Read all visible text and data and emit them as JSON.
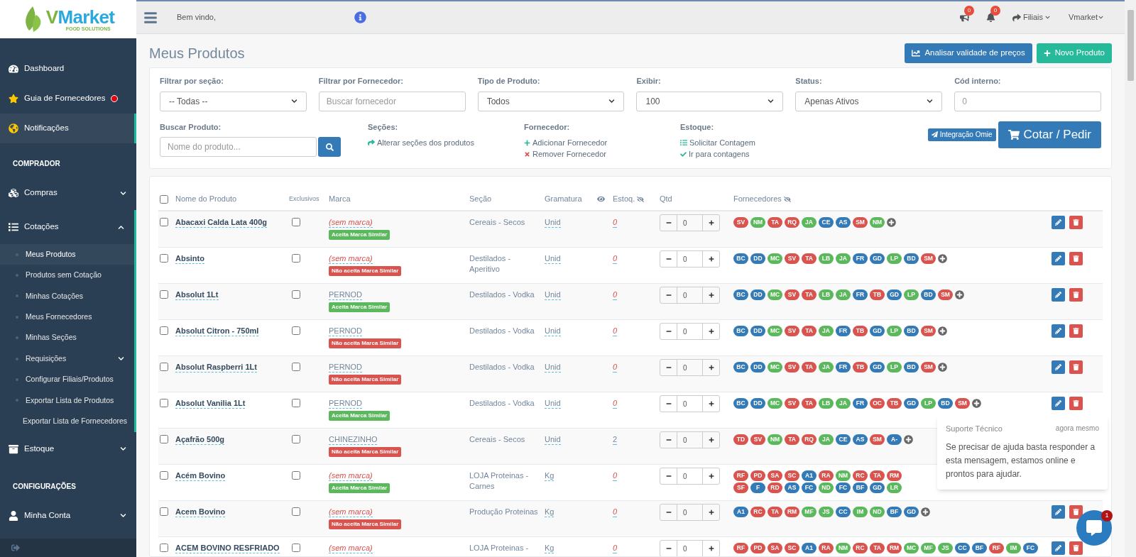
{
  "sidebar": {
    "logo_mark": "V",
    "logo_word": "Market",
    "logo_tagline": "FOOD SOLUTIONS",
    "items": [
      {
        "kind": "link",
        "label": "Dashboard",
        "selected": false,
        "alert": false
      },
      {
        "kind": "link",
        "label": "Guia de Fornecedores",
        "selected": false,
        "alert": true
      },
      {
        "kind": "link",
        "label": "Notificações",
        "selected": true,
        "alert": false
      },
      {
        "kind": "header",
        "label": "COMPRADOR"
      },
      {
        "kind": "group",
        "label": "Compras",
        "expanded": false
      },
      {
        "kind": "group",
        "label": "Cotações",
        "expanded": true,
        "children": [
          {
            "label": "Meus Produtos",
            "selected": true
          },
          {
            "label": "Produtos sem Cotação",
            "selected": false
          },
          {
            "label": "Minhas Cotações",
            "selected": false
          },
          {
            "label": "Meus Fornecedores",
            "selected": false
          },
          {
            "label": "Minhas Seções",
            "selected": false
          },
          {
            "label": "Requisições",
            "selected": false,
            "expandable": true
          },
          {
            "label": "Configurar Filiais/Produtos",
            "selected": false
          },
          {
            "label": "Exportar Lista de Produtos",
            "selected": false
          },
          {
            "label": "Exportar Lista de Fornecedores",
            "selected": false
          }
        ]
      },
      {
        "kind": "group",
        "label": "Estoque",
        "expanded": false
      },
      {
        "kind": "header",
        "label": "CONFIGURAÇÕES"
      },
      {
        "kind": "group",
        "label": "Minha Conta",
        "expanded": false
      }
    ]
  },
  "header": {
    "welcome": "Bem vindo,",
    "counters": [
      "0",
      "0"
    ],
    "branches": "Filiais",
    "user": "Vmarket"
  },
  "page": {
    "title": "Meus Produtos",
    "buttons": [
      {
        "kind": "primary",
        "label": "Analisar validade de preços"
      },
      {
        "kind": "success",
        "label": "Novo Produto"
      }
    ]
  },
  "filters": [
    {
      "kind": "select",
      "label": "Filtrar por seção:",
      "value": "-- Todas --"
    },
    {
      "kind": "input",
      "label": "Filtrar por Fornecedor:",
      "placeholder": "Buscar fornecedor"
    },
    {
      "kind": "select",
      "label": "Tipo de Produto:",
      "value": "Todos"
    },
    {
      "kind": "select",
      "label": "Exibir:",
      "value": "100"
    },
    {
      "kind": "select",
      "label": "Status:",
      "value": "Apenas Ativos"
    },
    {
      "kind": "input",
      "label": "Cód interno:",
      "placeholder": "0"
    }
  ],
  "search": {
    "label": "Buscar Produto:",
    "placeholder": "Nome do produto..."
  },
  "action_groups": [
    {
      "title": "Seções:",
      "links": [
        {
          "kind": "share",
          "text": "Alterar seções dos produtos"
        }
      ]
    },
    {
      "title": "Fornecedor:",
      "links": [
        {
          "kind": "add",
          "text": "Adicionar Fornecedor"
        },
        {
          "kind": "remove",
          "text": "Remover Fornecedor"
        }
      ]
    },
    {
      "title": "Estoque:",
      "links": [
        {
          "kind": "list",
          "text": "Solicitar Contagem"
        },
        {
          "kind": "check",
          "text": "Ir para contagens"
        }
      ]
    }
  ],
  "integration_button": "Integração Omie",
  "quote_button": "Cotar / Pedir",
  "table": {
    "select_all_checked": false,
    "columns": [
      "Nome do Produto",
      "Exclusivos",
      "Marca",
      "Seção",
      "Gramatura",
      "Estoq.",
      "Qtd",
      "Fornecedores"
    ],
    "rows": [
      {
        "checked": false,
        "name": "Abacaxi Calda Lata 400g",
        "exclusive": false,
        "brand": "(sem marca)",
        "brand_missing": true,
        "similar": {
          "text": "Aceita Marca Similar",
          "accepted": true
        },
        "section": "Cereais - Secos",
        "unit": "Unid",
        "stock": "0",
        "stock_alert": true,
        "qty": "0",
        "more": true,
        "show_actions": true,
        "supplier_lines": [
          [
            {
              "code": "SV",
              "color": "#d9534f"
            },
            {
              "code": "NM",
              "color": "#5cb85c"
            },
            {
              "code": "TA",
              "color": "#d9534f"
            },
            {
              "code": "RQ",
              "color": "#d9534f"
            },
            {
              "code": "JA",
              "color": "#5cb85c"
            },
            {
              "code": "CE",
              "color": "#337ab7"
            },
            {
              "code": "AS",
              "color": "#337ab7"
            },
            {
              "code": "SM",
              "color": "#d9534f"
            },
            {
              "code": "NM",
              "color": "#5cb85c"
            }
          ]
        ]
      },
      {
        "checked": false,
        "name": "Absinto",
        "exclusive": false,
        "brand": "(sem marca)",
        "brand_missing": true,
        "similar": {
          "text": "Não aceita Marca Similar",
          "accepted": false
        },
        "section": "Destilados - Aperitivo",
        "unit": "Unid",
        "stock": "0",
        "stock_alert": true,
        "qty": "0",
        "more": true,
        "show_actions": true,
        "supplier_lines": [
          [
            {
              "code": "BC",
              "color": "#337ab7"
            },
            {
              "code": "DD",
              "color": "#337ab7"
            },
            {
              "code": "MC",
              "color": "#5cb85c"
            },
            {
              "code": "SV",
              "color": "#d9534f"
            },
            {
              "code": "TA",
              "color": "#d9534f"
            },
            {
              "code": "LB",
              "color": "#5cb85c"
            },
            {
              "code": "JA",
              "color": "#5cb85c"
            },
            {
              "code": "FR",
              "color": "#337ab7"
            },
            {
              "code": "GD",
              "color": "#337ab7"
            },
            {
              "code": "LP",
              "color": "#5cb85c"
            },
            {
              "code": "BD",
              "color": "#337ab7"
            },
            {
              "code": "SM",
              "color": "#d9534f"
            }
          ]
        ]
      },
      {
        "checked": false,
        "name": "Absolut 1Lt",
        "exclusive": false,
        "brand": "PERNOD",
        "brand_missing": false,
        "similar": {
          "text": "Aceita Marca Similar",
          "accepted": true
        },
        "section": "Destilados - Vodka",
        "unit": "Unid",
        "stock": "0",
        "stock_alert": true,
        "qty": "0",
        "more": true,
        "show_actions": true,
        "supplier_lines": [
          [
            {
              "code": "BC",
              "color": "#337ab7"
            },
            {
              "code": "DD",
              "color": "#337ab7"
            },
            {
              "code": "MC",
              "color": "#5cb85c"
            },
            {
              "code": "SV",
              "color": "#d9534f"
            },
            {
              "code": "TA",
              "color": "#d9534f"
            },
            {
              "code": "LB",
              "color": "#5cb85c"
            },
            {
              "code": "JA",
              "color": "#5cb85c"
            },
            {
              "code": "FR",
              "color": "#337ab7"
            },
            {
              "code": "TB",
              "color": "#d9534f"
            },
            {
              "code": "GD",
              "color": "#337ab7"
            },
            {
              "code": "LP",
              "color": "#5cb85c"
            },
            {
              "code": "BD",
              "color": "#337ab7"
            },
            {
              "code": "SM",
              "color": "#d9534f"
            }
          ]
        ]
      },
      {
        "checked": false,
        "name": "Absolut Citron - 750ml",
        "exclusive": false,
        "brand": "PERNOD",
        "brand_missing": false,
        "similar": {
          "text": "Não aceita Marca Similar",
          "accepted": false
        },
        "section": "Destilados - Vodka",
        "unit": "Unid",
        "stock": "0",
        "stock_alert": true,
        "qty": "0",
        "more": true,
        "show_actions": true,
        "supplier_lines": [
          [
            {
              "code": "BC",
              "color": "#337ab7"
            },
            {
              "code": "DD",
              "color": "#337ab7"
            },
            {
              "code": "MC",
              "color": "#5cb85c"
            },
            {
              "code": "SV",
              "color": "#d9534f"
            },
            {
              "code": "TA",
              "color": "#d9534f"
            },
            {
              "code": "JA",
              "color": "#5cb85c"
            },
            {
              "code": "FR",
              "color": "#337ab7"
            },
            {
              "code": "TB",
              "color": "#d9534f"
            },
            {
              "code": "GD",
              "color": "#337ab7"
            },
            {
              "code": "LP",
              "color": "#5cb85c"
            },
            {
              "code": "BD",
              "color": "#337ab7"
            },
            {
              "code": "SM",
              "color": "#d9534f"
            }
          ]
        ]
      },
      {
        "checked": false,
        "name": "Absolut Raspberri 1Lt",
        "exclusive": false,
        "brand": "PERNOD",
        "brand_missing": false,
        "similar": {
          "text": "Não aceita Marca Similar",
          "accepted": false
        },
        "section": "Destilados - Vodka",
        "unit": "Unid",
        "stock": "0",
        "stock_alert": true,
        "qty": "0",
        "more": true,
        "show_actions": true,
        "supplier_lines": [
          [
            {
              "code": "BC",
              "color": "#337ab7"
            },
            {
              "code": "DD",
              "color": "#337ab7"
            },
            {
              "code": "MC",
              "color": "#5cb85c"
            },
            {
              "code": "SV",
              "color": "#d9534f"
            },
            {
              "code": "TA",
              "color": "#d9534f"
            },
            {
              "code": "JA",
              "color": "#5cb85c"
            },
            {
              "code": "FR",
              "color": "#337ab7"
            },
            {
              "code": "TB",
              "color": "#d9534f"
            },
            {
              "code": "GD",
              "color": "#337ab7"
            },
            {
              "code": "LP",
              "color": "#5cb85c"
            },
            {
              "code": "BD",
              "color": "#337ab7"
            },
            {
              "code": "SM",
              "color": "#d9534f"
            }
          ]
        ]
      },
      {
        "checked": false,
        "name": "Absolut Vanilia 1Lt",
        "exclusive": false,
        "brand": "PERNOD",
        "brand_missing": false,
        "similar": {
          "text": "Aceita Marca Similar",
          "accepted": true
        },
        "section": "Destilados - Vodka",
        "unit": "Unid",
        "stock": "0",
        "stock_alert": true,
        "qty": "0",
        "more": true,
        "show_actions": true,
        "supplier_lines": [
          [
            {
              "code": "BC",
              "color": "#337ab7"
            },
            {
              "code": "DD",
              "color": "#337ab7"
            },
            {
              "code": "MC",
              "color": "#5cb85c"
            },
            {
              "code": "SV",
              "color": "#d9534f"
            },
            {
              "code": "TA",
              "color": "#d9534f"
            },
            {
              "code": "LB",
              "color": "#5cb85c"
            },
            {
              "code": "JA",
              "color": "#5cb85c"
            },
            {
              "code": "FR",
              "color": "#337ab7"
            },
            {
              "code": "OC",
              "color": "#d9534f"
            },
            {
              "code": "TB",
              "color": "#d9534f"
            },
            {
              "code": "GD",
              "color": "#337ab7"
            },
            {
              "code": "LP",
              "color": "#5cb85c"
            },
            {
              "code": "BD",
              "color": "#337ab7"
            },
            {
              "code": "SM",
              "color": "#d9534f"
            }
          ]
        ]
      },
      {
        "checked": false,
        "name": "Açafrão 500g",
        "exclusive": false,
        "brand": "CHINEZINHO",
        "brand_missing": false,
        "similar": {
          "text": "Não aceita Marca Similar",
          "accepted": false
        },
        "section": "Cereais - Secos",
        "unit": "Unid",
        "stock": "2",
        "stock_alert": false,
        "qty": "0",
        "more": true,
        "show_actions": false,
        "supplier_lines": [
          [
            {
              "code": "TD",
              "color": "#d9534f"
            },
            {
              "code": "SV",
              "color": "#d9534f"
            },
            {
              "code": "NM",
              "color": "#5cb85c"
            },
            {
              "code": "TA",
              "color": "#d9534f"
            },
            {
              "code": "RQ",
              "color": "#d9534f"
            },
            {
              "code": "JA",
              "color": "#5cb85c"
            },
            {
              "code": "CE",
              "color": "#337ab7"
            },
            {
              "code": "AS",
              "color": "#337ab7"
            },
            {
              "code": "SM",
              "color": "#d9534f"
            },
            {
              "code": "A-",
              "color": "#337ab7"
            }
          ]
        ]
      },
      {
        "checked": false,
        "name": "Acém Bovino",
        "exclusive": false,
        "brand": "(sem marca)",
        "brand_missing": true,
        "similar": {
          "text": "Aceita Marca Similar",
          "accepted": true
        },
        "section": "LOJA Proteinas - Carnes",
        "unit": "Kg",
        "stock": "0",
        "stock_alert": true,
        "qty": "0",
        "more": false,
        "show_actions": false,
        "supplier_lines": [
          [
            {
              "code": "RF",
              "color": "#d9534f"
            },
            {
              "code": "PD",
              "color": "#d9534f"
            },
            {
              "code": "SA",
              "color": "#d9534f"
            },
            {
              "code": "SC",
              "color": "#d9534f"
            },
            {
              "code": "A1",
              "color": "#337ab7"
            },
            {
              "code": "RA",
              "color": "#d9534f"
            },
            {
              "code": "NM",
              "color": "#5cb85c"
            },
            {
              "code": "RC",
              "color": "#d9534f"
            },
            {
              "code": "TA",
              "color": "#d9534f"
            },
            {
              "code": "RM",
              "color": "#d9534f"
            }
          ],
          [
            {
              "code": "SF",
              "color": "#d9534f"
            },
            {
              "code": "F",
              "color": "#337ab7"
            },
            {
              "code": "RD",
              "color": "#d9534f"
            },
            {
              "code": "AS",
              "color": "#337ab7"
            },
            {
              "code": "FC",
              "color": "#337ab7"
            },
            {
              "code": "ND",
              "color": "#5cb85c"
            },
            {
              "code": "FC",
              "color": "#337ab7"
            },
            {
              "code": "BF",
              "color": "#337ab7"
            },
            {
              "code": "GD",
              "color": "#337ab7"
            },
            {
              "code": "LR",
              "color": "#5cb85c"
            }
          ]
        ]
      },
      {
        "checked": false,
        "name": "Acem Bovino",
        "exclusive": false,
        "brand": "(sem marca)",
        "brand_missing": true,
        "similar": {
          "text": "Não aceita Marca Similar",
          "accepted": false
        },
        "section": "Produção Proteinas",
        "unit": "Kg",
        "stock": "0",
        "stock_alert": true,
        "qty": "0",
        "more": true,
        "show_actions": true,
        "supplier_lines": [
          [
            {
              "code": "A1",
              "color": "#337ab7"
            },
            {
              "code": "RC",
              "color": "#d9534f"
            },
            {
              "code": "TA",
              "color": "#d9534f"
            },
            {
              "code": "RM",
              "color": "#d9534f"
            },
            {
              "code": "MF",
              "color": "#5cb85c"
            },
            {
              "code": "JS",
              "color": "#5cb85c"
            },
            {
              "code": "CC",
              "color": "#337ab7"
            },
            {
              "code": "IM",
              "color": "#5cb85c"
            },
            {
              "code": "ND",
              "color": "#5cb85c"
            },
            {
              "code": "BF",
              "color": "#337ab7"
            },
            {
              "code": "GD",
              "color": "#337ab7"
            }
          ]
        ]
      },
      {
        "checked": false,
        "name": "ACEM BOVINO RESFRIADO",
        "exclusive": false,
        "brand": "(sem marca)",
        "brand_missing": true,
        "section": "LOJA Proteinas -",
        "unit": "Kg",
        "stock": "0",
        "stock_alert": true,
        "qty": "0",
        "more": false,
        "show_actions": true,
        "supplier_lines": [
          [
            {
              "code": "RF",
              "color": "#d9534f"
            },
            {
              "code": "PD",
              "color": "#d9534f"
            },
            {
              "code": "SA",
              "color": "#d9534f"
            },
            {
              "code": "SC",
              "color": "#d9534f"
            },
            {
              "code": "A1",
              "color": "#337ab7"
            },
            {
              "code": "RA",
              "color": "#d9534f"
            },
            {
              "code": "NM",
              "color": "#5cb85c"
            },
            {
              "code": "RC",
              "color": "#d9534f"
            },
            {
              "code": "TA",
              "color": "#d9534f"
            },
            {
              "code": "RM",
              "color": "#d9534f"
            },
            {
              "code": "MC",
              "color": "#5cb85c"
            },
            {
              "code": "MF",
              "color": "#5cb85c"
            },
            {
              "code": "JS",
              "color": "#5cb85c"
            },
            {
              "code": "CC",
              "color": "#337ab7"
            },
            {
              "code": "BF",
              "color": "#337ab7"
            },
            {
              "code": "RF",
              "color": "#d9534f"
            },
            {
              "code": "IM",
              "color": "#5cb85c"
            },
            {
              "code": "FC",
              "color": "#337ab7"
            }
          ]
        ]
      }
    ]
  },
  "chat": {
    "sender": "Suporte Técnico",
    "time": "agora mesmo",
    "message": "Se precisar de ajuda basta responder a esta mensagem, estamos online e prontos para ajudar.",
    "unread": "1"
  }
}
